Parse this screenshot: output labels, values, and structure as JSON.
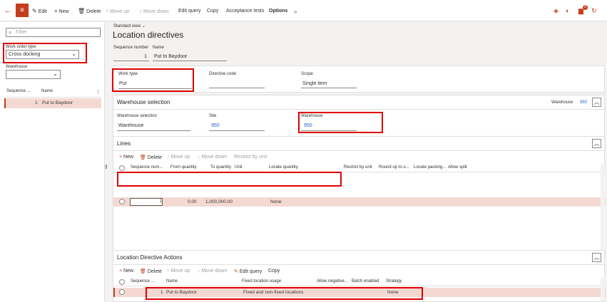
{
  "toolbar": {
    "edit": "Edit",
    "new": "New",
    "delete": "Delete",
    "move_up": "Move up",
    "move_down": "Move down",
    "edit_query": "Edit query",
    "copy": "Copy",
    "acceptance_tests": "Acceptance tests",
    "options": "Options",
    "notification_count": "0"
  },
  "left": {
    "filter_placeholder": "Filter",
    "work_order_type_label": "Work order type",
    "work_order_type_value": "Cross docking",
    "warehouse_label": "Warehouse",
    "warehouse_value": "",
    "col_sequence": "Sequence ...",
    "col_name": "Name",
    "rows": [
      {
        "sequence": "1",
        "name": "Put to Baydoor"
      }
    ]
  },
  "header": {
    "view": "Standard view",
    "title": "Location directives",
    "sequence_label": "Sequence number",
    "sequence_value": "1",
    "name_label": "Name",
    "name_value": "Put to Baydoor",
    "work_type_label": "Work type",
    "work_type_value": "Put",
    "directive_code_label": "Directive code",
    "directive_code_value": "",
    "scope_label": "Scope",
    "scope_value": "Single item"
  },
  "warehouse_selection": {
    "title": "Warehouse selection",
    "summary_label": "Warehouse",
    "summary_value": "950",
    "selection_label": "Warehouse selection",
    "selection_value": "Warehouse",
    "site_label": "Site",
    "site_value": "950",
    "warehouse_label": "Warehouse",
    "warehouse_value": "950"
  },
  "lines": {
    "title": "Lines",
    "toolbar": {
      "new": "New",
      "delete": "Delete",
      "move_up": "Move up",
      "move_down": "Move down",
      "restrict": "Restrict by unit"
    },
    "columns": [
      "Sequence num...",
      "From quantity",
      "To quantity",
      "Unit",
      "Locate quantity",
      "Restrict by unit",
      "Round up to u...",
      "Locate packing...",
      "Allow split"
    ],
    "rows": [
      {
        "sequence": "1",
        "from_qty": "0.00",
        "to_qty": "1,000,000.00",
        "unit": "",
        "locate_qty": "None"
      }
    ]
  },
  "actions": {
    "title": "Location Directive Actions",
    "toolbar": {
      "new": "New",
      "delete": "Delete",
      "move_up": "Move up",
      "move_down": "Move down",
      "edit_query": "Edit query",
      "copy": "Copy"
    },
    "columns": [
      "Sequence ...",
      "Name",
      "Fixed location usage",
      "Allow negative...",
      "Batch enabled",
      "Strategy"
    ],
    "rows": [
      {
        "sequence": "1",
        "name": "Put to Baydoor",
        "fixed_usage": "Fixed and non-fixed locations",
        "strategy": "None"
      }
    ]
  },
  "colors": {
    "accent": "#c43e1c",
    "highlight": "#e00000",
    "link": "#2266c9"
  }
}
